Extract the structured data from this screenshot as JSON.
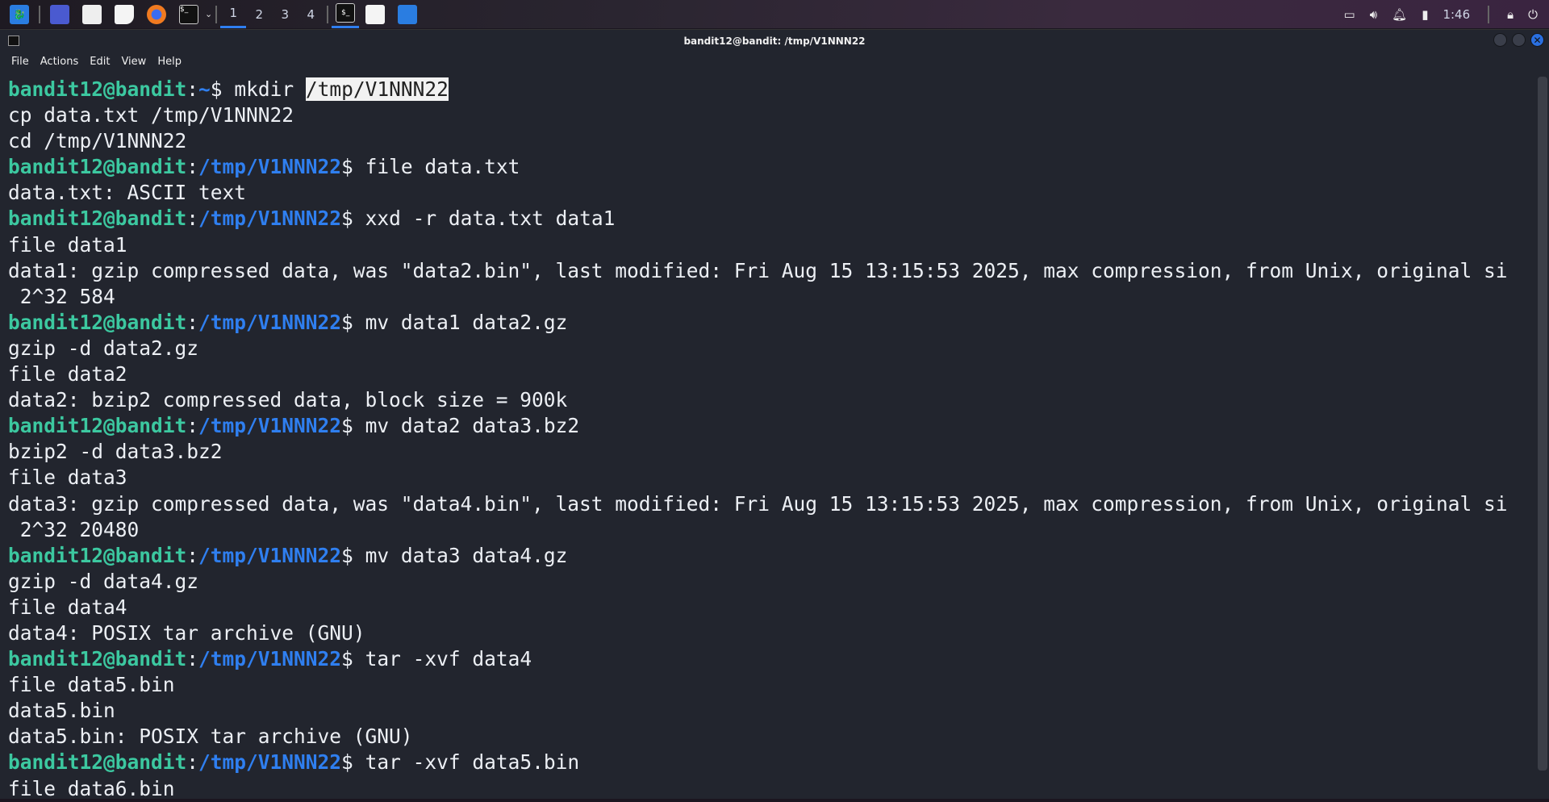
{
  "taskbar": {
    "workspaces": [
      "1",
      "2",
      "3",
      "4"
    ],
    "active_workspace": "1",
    "clock": "1:46",
    "icons": [
      "kali-menu-icon",
      "show-desktop-icon",
      "file-manager-icon",
      "text-editor-icon",
      "firefox-icon",
      "terminal-icon",
      "chevron-down-icon"
    ],
    "tray_icons": [
      "network-icon",
      "volume-icon",
      "notification-bell-icon",
      "battery-icon",
      "lock-icon",
      "logout-icon"
    ],
    "accent": "#2f7ff0"
  },
  "window": {
    "title": "bandit12@bandit: /tmp/V1NNN22",
    "menu": [
      "File",
      "Actions",
      "Edit",
      "View",
      "Help"
    ]
  },
  "terminal": {
    "user": "bandit12@bandit",
    "lines": [
      {
        "path": "~",
        "cmd": "mkdir ",
        "sel": "/tmp/V1NNN22"
      },
      {
        "text": "cp data.txt /tmp/V1NNN22"
      },
      {
        "text": "cd /tmp/V1NNN22"
      },
      {
        "path": "/tmp/V1NNN22",
        "cmd": "file data.txt"
      },
      {
        "text": "data.txt: ASCII text"
      },
      {
        "path": "/tmp/V1NNN22",
        "cmd": "xxd -r data.txt data1"
      },
      {
        "text": "file data1"
      },
      {
        "text": "data1: gzip compressed data, was \"data2.bin\", last modified: Fri Aug 15 13:15:53 2025, max compression, from Unix, original si"
      },
      {
        "text": " 2^32 584"
      },
      {
        "path": "/tmp/V1NNN22",
        "cmd": "mv data1 data2.gz"
      },
      {
        "text": "gzip -d data2.gz"
      },
      {
        "text": "file data2"
      },
      {
        "text": "data2: bzip2 compressed data, block size = 900k"
      },
      {
        "path": "/tmp/V1NNN22",
        "cmd": "mv data2 data3.bz2"
      },
      {
        "text": "bzip2 -d data3.bz2"
      },
      {
        "text": "file data3"
      },
      {
        "text": "data3: gzip compressed data, was \"data4.bin\", last modified: Fri Aug 15 13:15:53 2025, max compression, from Unix, original si"
      },
      {
        "text": " 2^32 20480"
      },
      {
        "path": "/tmp/V1NNN22",
        "cmd": "mv data3 data4.gz"
      },
      {
        "text": "gzip -d data4.gz"
      },
      {
        "text": "file data4"
      },
      {
        "text": "data4: POSIX tar archive (GNU)"
      },
      {
        "path": "/tmp/V1NNN22",
        "cmd": "tar -xvf data4"
      },
      {
        "text": "file data5.bin"
      },
      {
        "text": "data5.bin"
      },
      {
        "text": "data5.bin: POSIX tar archive (GNU)"
      },
      {
        "path": "/tmp/V1NNN22",
        "cmd": "tar -xvf data5.bin"
      },
      {
        "text": "file data6.bin"
      }
    ]
  }
}
